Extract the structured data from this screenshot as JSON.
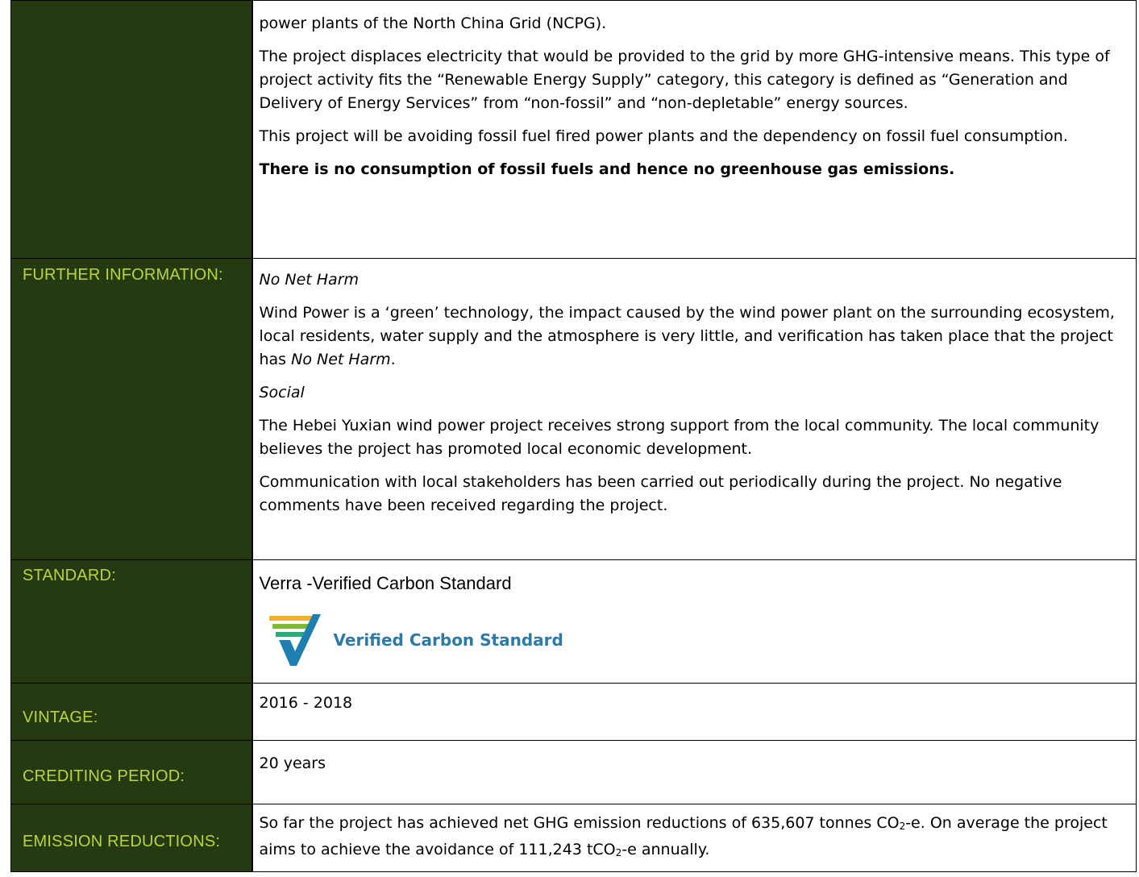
{
  "rows": {
    "intro": {
      "p1": "power plants of the North China Grid (NCPG).",
      "p2": "The project displaces electricity that would be provided to the grid by more GHG-intensive means. This type of project activity fits the “Renewable Energy Supply” category, this category is defined as “Generation and Delivery of Energy Services” from “non-fossil” and “non-depletable” energy sources.",
      "p3": "This project will be avoiding fossil fuel fired power plants and the dependency on fossil fuel consumption.",
      "p4": "There is no consumption of fossil fuels and hence no greenhouse gas emissions."
    },
    "further": {
      "label": "FURTHER INFORMATION:",
      "h1": "No Net Harm",
      "p1a": "Wind Power is a ‘green’ technology, the impact caused by the wind power plant on the surrounding ecosystem, local residents, water supply and the atmosphere is very little, and verification has taken place that the project has ",
      "p1b": "No Net Harm",
      "p1c": ".",
      "h2": "Social",
      "p2": "The Hebei Yuxian wind power project receives strong support from the local community. The local community believes the project has promoted local economic development.",
      "p3": "Communication with local stakeholders has been carried out periodically during the project. No negative comments have been received regarding the project."
    },
    "standard": {
      "label": "STANDARD:",
      "value": "Verra -Verified Carbon Standard",
      "logo_text": "Verified Carbon Standard"
    },
    "vintage": {
      "label": "VINTAGE:",
      "value": "2016 - 2018"
    },
    "crediting": {
      "label": "CREDITING PERIOD:",
      "value": "20 years"
    },
    "emission": {
      "label": "EMISSION REDUCTIONS:",
      "t1": "So far the project has achieved net GHG emission reductions of 635,607 tonnes CO",
      "sub1": "2",
      "t2": "-e. On average the project aims to achieve the avoidance of 111,243 tCO",
      "sub2": "2",
      "t3": "-e annually."
    }
  },
  "colors": {
    "label_bg": "#263a11",
    "label_text": "#b6d63a",
    "logo_blue": "#2b7aa8"
  }
}
